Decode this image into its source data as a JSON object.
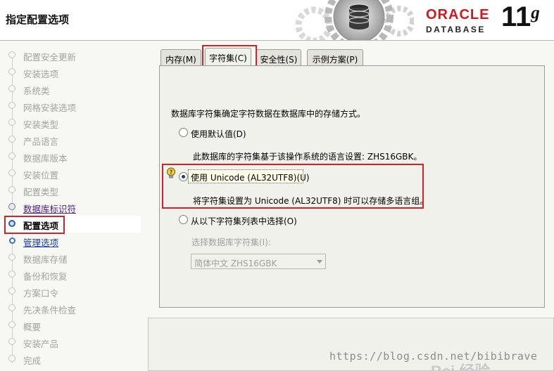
{
  "window": {
    "title": "指定配置选项"
  },
  "brand": {
    "oracle": "ORACLE",
    "database": "DATABASE",
    "version": "11",
    "version_suffix": "g"
  },
  "sidebar": {
    "steps": [
      {
        "label": "配置安全更新",
        "state": "disabled"
      },
      {
        "label": "安装选项",
        "state": "disabled"
      },
      {
        "label": "系统类",
        "state": "disabled"
      },
      {
        "label": "网格安装选项",
        "state": "disabled"
      },
      {
        "label": "安装类型",
        "state": "disabled"
      },
      {
        "label": "产品语言",
        "state": "disabled"
      },
      {
        "label": "数据库版本",
        "state": "disabled"
      },
      {
        "label": "安装位置",
        "state": "disabled"
      },
      {
        "label": "配置类型",
        "state": "disabled"
      },
      {
        "label": "数据库标识符",
        "state": "done"
      },
      {
        "label": "配置选项",
        "state": "current"
      },
      {
        "label": "管理选项",
        "state": "next"
      },
      {
        "label": "数据库存储",
        "state": "disabled"
      },
      {
        "label": "备份和恢复",
        "state": "disabled"
      },
      {
        "label": "方案口令",
        "state": "disabled"
      },
      {
        "label": "先决条件检查",
        "state": "disabled"
      },
      {
        "label": "概要",
        "state": "disabled"
      },
      {
        "label": "安装产品",
        "state": "disabled"
      },
      {
        "label": "完成",
        "state": "disabled"
      }
    ]
  },
  "tabs": [
    {
      "label": "内存(M)",
      "active": false
    },
    {
      "label": "字符集(C)",
      "active": true
    },
    {
      "label": "安全性(S)",
      "active": false
    },
    {
      "label": "示例方案(P)",
      "active": false
    }
  ],
  "charset": {
    "intro": "数据库字符集确定字符数据在数据库中的存储方式。",
    "option_default": {
      "label": "使用默认值(D)",
      "selected": false
    },
    "default_desc": "此数据库的字符集基于该操作系统的语言设置: ZHS16GBK。",
    "option_unicode": {
      "label": "使用 Unicode (AL32UTF8)(U)",
      "selected": true
    },
    "unicode_desc": "将字符集设置为 Unicode (AL32UTF8) 时可以存储多语言组。",
    "option_list": {
      "label": "从以下字符集列表中选择(O)",
      "selected": false
    },
    "list_field_label": "选择数据库字符集(I):",
    "list_value": "简体中文 ZHS16GBK"
  },
  "watermark": {
    "url": "https://blog.csdn.net/bibibrave",
    "logo": "Bai  经验"
  },
  "colors": {
    "highlight_red": "#d0242a",
    "oracle_red": "#d0181f",
    "selected_blue": "#2b5fb1"
  }
}
